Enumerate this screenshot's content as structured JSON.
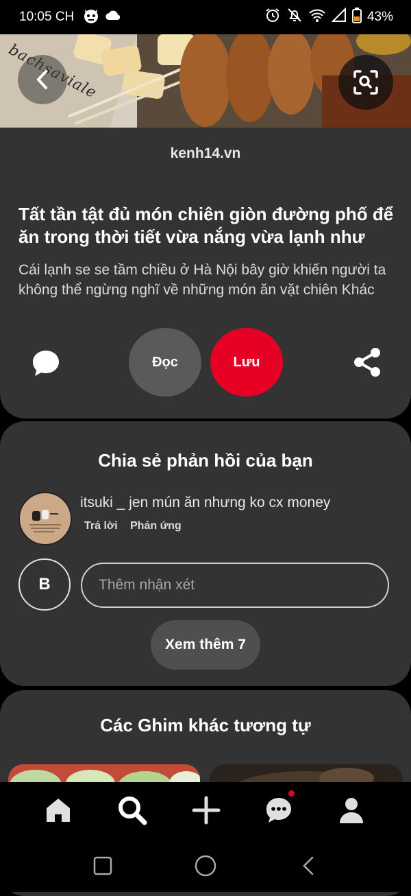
{
  "status_bar": {
    "time": "10:05 CH",
    "battery": "43%"
  },
  "pin": {
    "source": "kenh14.vn",
    "title": "Tất tần tật đủ món chiên giòn đường phố để ăn trong thời tiết vừa nắng vừa lạnh như",
    "description": "Cái lạnh se se tầm chiều ở Hà Nội bây giờ khiến người ta không thể ngừng nghĩ về những món ăn vặt chiên Khác",
    "read_label": "Đọc",
    "save_label": "Lưu",
    "save_color": "#e60023",
    "image_watermark": "bachsaviale"
  },
  "comments": {
    "heading": "Chia sẻ phản hồi của bạn",
    "items": [
      {
        "author": "itsuki _",
        "text": "itsuki _ jen mún ăn nhưng ko cx money",
        "reply_label": "Trả lời",
        "react_label": "Phản ứng"
      }
    ],
    "user_initial": "B",
    "input_placeholder": "Thêm nhận xét",
    "see_more_label": "Xem thêm 7"
  },
  "similar": {
    "heading": "Các Ghim khác tương tự"
  },
  "bottom_nav": {
    "items": [
      "home-icon",
      "search-icon",
      "create-icon",
      "messages-icon",
      "profile-icon"
    ],
    "active": "search-icon",
    "notification_color": "#e60023"
  }
}
